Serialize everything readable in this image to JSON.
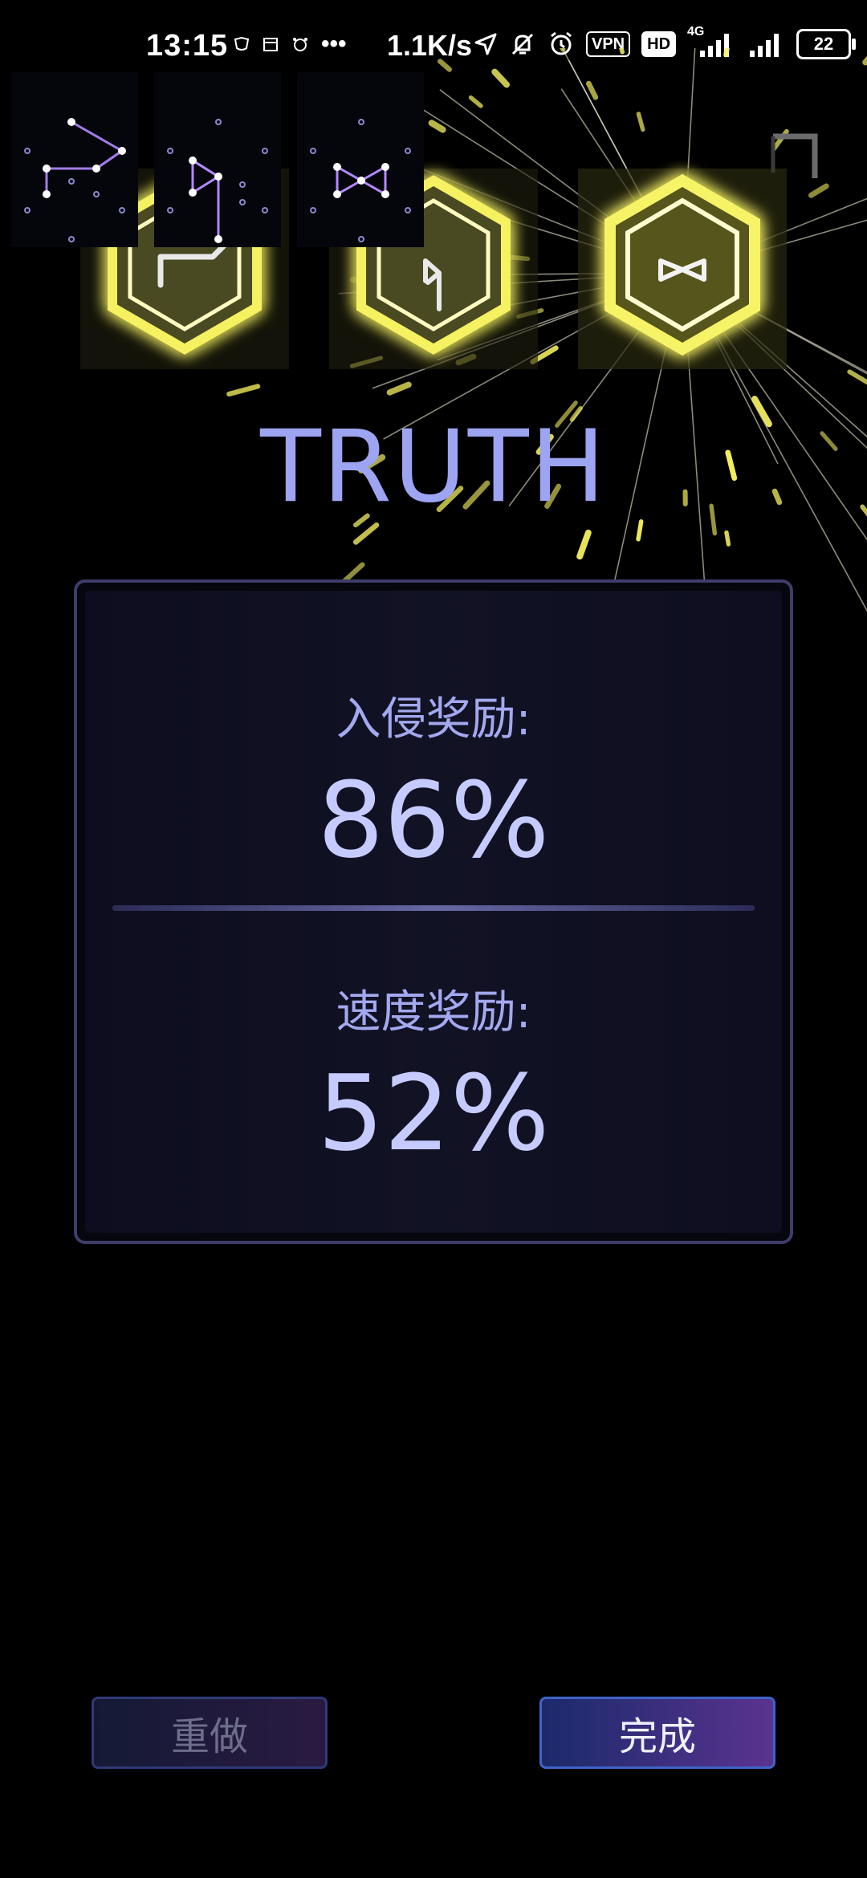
{
  "status_bar": {
    "time": "13:15",
    "network_speed": "1.1K/s",
    "vpn": "VPN",
    "hd": "HD",
    "mobile_network": "4G",
    "battery": "22"
  },
  "glyph_sequence": [
    "glyph-1",
    "glyph-2",
    "glyph-3"
  ],
  "result": {
    "title": "TRUTH",
    "invasion_bonus_label": "入侵奖励:",
    "invasion_bonus_value": "86%",
    "speed_bonus_label": "速度奖励:",
    "speed_bonus_value": "52%"
  },
  "buttons": {
    "redo": "重做",
    "done": "完成"
  },
  "colors": {
    "accent": "#9da5f2",
    "glow": "#f5f160",
    "button_done": "#3f63c7"
  }
}
